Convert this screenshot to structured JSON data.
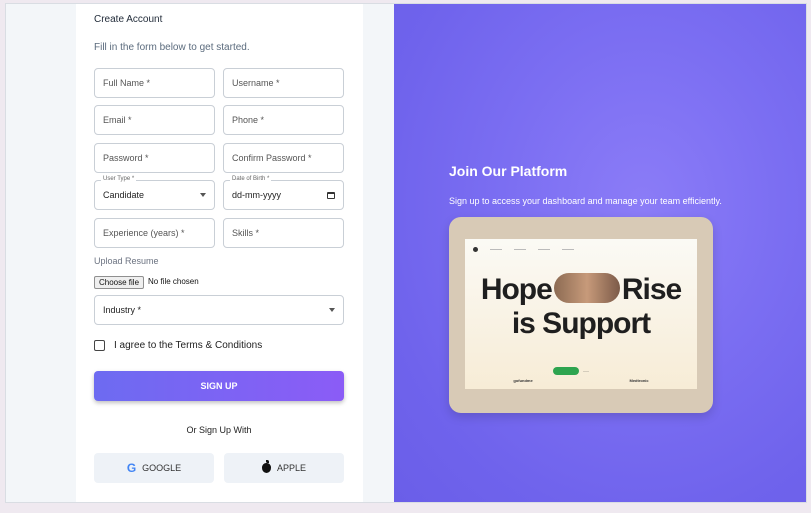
{
  "form": {
    "title": "Create Account",
    "subtitle": "Fill in the form below to get started.",
    "full_name_placeholder": "Full Name *",
    "username_placeholder": "Username *",
    "email_placeholder": "Email *",
    "phone_placeholder": "Phone *",
    "password_placeholder": "Password *",
    "confirm_password_placeholder": "Confirm Password *",
    "user_type_label": "User Type *",
    "user_type_value": "Candidate",
    "dob_label": "Date of Birth *",
    "dob_value": "dd-mm-yyyy",
    "experience_placeholder": "Experience (years) *",
    "skills_placeholder": "Skills *",
    "upload_label": "Upload Resume",
    "choose_file_label": "Choose file",
    "no_file_text": "No file chosen",
    "industry_placeholder": "Industry *",
    "terms_text": "I agree to the Terms & Conditions",
    "signup_label": "SIGN UP",
    "or_text": "Or Sign Up With",
    "google_label": "GOOGLE",
    "apple_label": "APPLE"
  },
  "promo": {
    "title": "Join Our Platform",
    "subtitle": "Sign up to access your dashboard and manage your team efficiently.",
    "hero_line1_left": "Hope",
    "hero_line1_right": "Rise",
    "hero_line2": "is Support",
    "logos": [
      "gofundme",
      "Medtronic"
    ]
  },
  "colors": {
    "accent": "#6d6bf1",
    "accent_end": "#8b5cf6",
    "panel_bg": "#7b6ef2"
  }
}
